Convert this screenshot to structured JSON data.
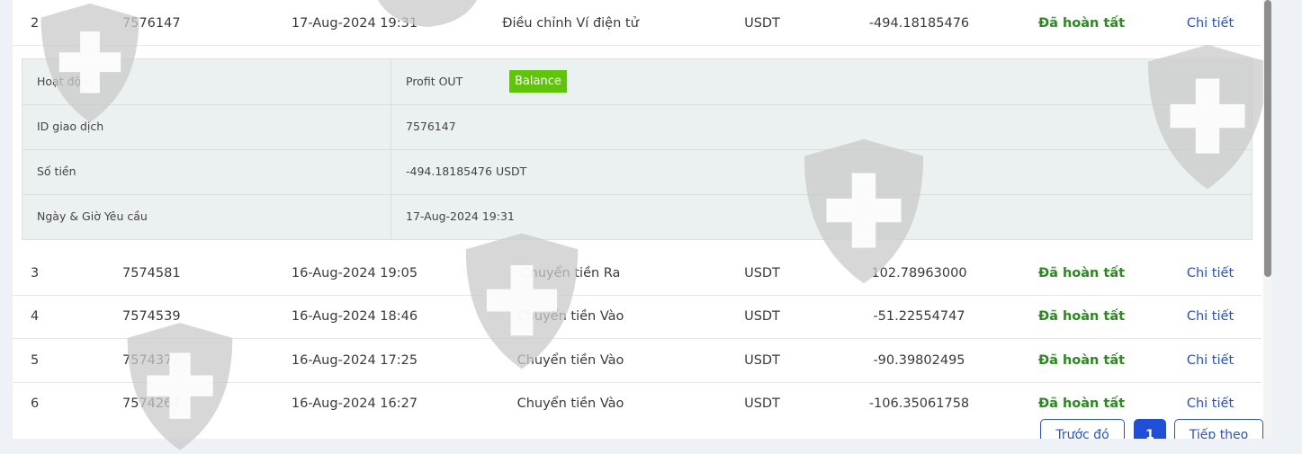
{
  "rows": [
    {
      "idx": "2",
      "id": "7576147",
      "date": "17-Aug-2024 19:31",
      "type": "Điều chỉnh Ví điện tử",
      "currency": "USDT",
      "amount": "-494.18185476",
      "status": "Đã hoàn tất",
      "link": "Chi tiết"
    },
    {
      "idx": "3",
      "id": "7574581",
      "date": "16-Aug-2024 19:05",
      "type": "Chuyển tiền Ra",
      "currency": "USDT",
      "amount": "102.78963000",
      "status": "Đã hoàn tất",
      "link": "Chi tiết"
    },
    {
      "idx": "4",
      "id": "7574539",
      "date": "16-Aug-2024 18:46",
      "type": "Chuyển tiền Vào",
      "currency": "USDT",
      "amount": "-51.22554747",
      "status": "Đã hoàn tất",
      "link": "Chi tiết"
    },
    {
      "idx": "5",
      "id": "7574372",
      "date": "16-Aug-2024 17:25",
      "type": "Chuyển tiền Vào",
      "currency": "USDT",
      "amount": "-90.39802495",
      "status": "Đã hoàn tất",
      "link": "Chi tiết"
    },
    {
      "idx": "6",
      "id": "7574264",
      "date": "16-Aug-2024 16:27",
      "type": "Chuyển tiền Vào",
      "currency": "USDT",
      "amount": "-106.35061758",
      "status": "Đã hoàn tất",
      "link": "Chi tiết"
    }
  ],
  "detail": {
    "activity_label": "Hoạt động",
    "activity_value": "Profit OUT",
    "activity_badge": "Balance",
    "txid_label": "ID giao dịch",
    "txid_value": "7576147",
    "amount_label": "Số tiền",
    "amount_value": "-494.18185476 USDT",
    "datetime_label": "Ngày & Giờ Yêu cầu",
    "datetime_value": "17-Aug-2024 19:31"
  },
  "pagination": {
    "prev": "Trước đó",
    "current": "1",
    "next": "Tiếp theo"
  },
  "colors": {
    "status": "#2a8a1e",
    "link": "#2a52c9",
    "badge": "#5ec50b",
    "active_page": "#1e4fd6",
    "watermark": "#c9c9c9"
  },
  "icons": {
    "watermark": "shield-cross-icon"
  }
}
